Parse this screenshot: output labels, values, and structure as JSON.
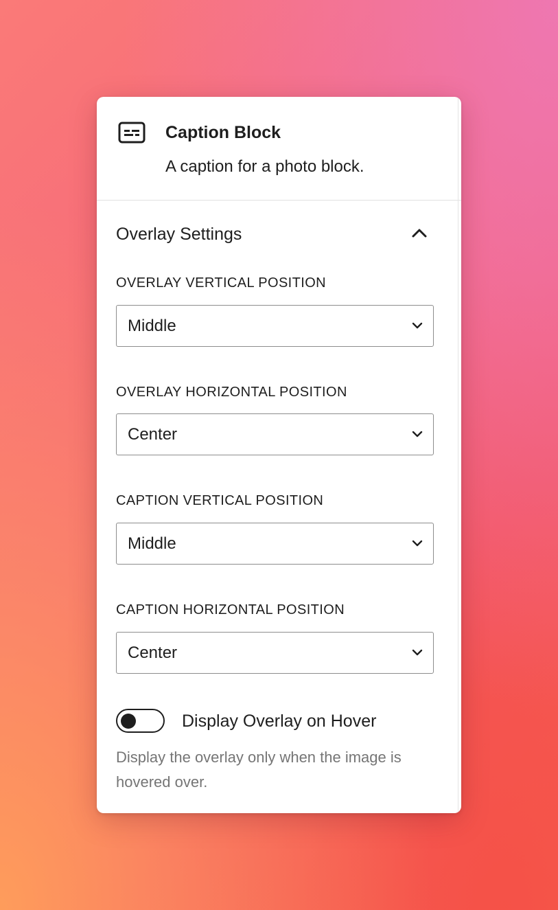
{
  "block": {
    "icon": "caption-icon",
    "title": "Caption Block",
    "description": "A caption for a photo block."
  },
  "section": {
    "title": "Overlay Settings",
    "toggle_icon": "chevron-up-icon",
    "expanded": true
  },
  "fields": [
    {
      "label": "OVERLAY VERTICAL POSITION",
      "value": "Middle"
    },
    {
      "label": "OVERLAY HORIZONTAL POSITION",
      "value": "Center"
    },
    {
      "label": "CAPTION VERTICAL POSITION",
      "value": "Middle"
    },
    {
      "label": "CAPTION HORIZONTAL POSITION",
      "value": "Center"
    }
  ],
  "hover_toggle": {
    "label": "Display Overlay on Hover",
    "checked": false,
    "help": "Display the overlay only when the image is hovered over."
  },
  "colors": {
    "text": "#1e1e1e",
    "muted": "#757575",
    "border": "#8c8c8c"
  }
}
